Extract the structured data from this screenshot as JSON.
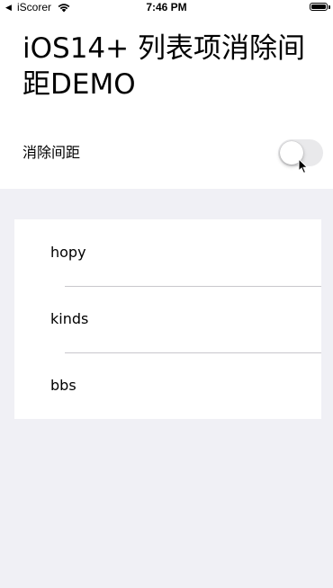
{
  "status_bar": {
    "back_glyph": "◀",
    "carrier": "iScorer",
    "wifi_icon": "wifi-icon",
    "time": "7:46 PM",
    "battery_icon": "battery-icon",
    "battery_level": 1.0
  },
  "header": {
    "title": "iOS14+ 列表项消除间距DEMO"
  },
  "settings": {
    "toggle_label": "消除间距",
    "toggle_on": false
  },
  "list": {
    "items": [
      {
        "label": "hopy"
      },
      {
        "label": "kinds"
      },
      {
        "label": "bbs"
      }
    ]
  },
  "colors": {
    "background": "#f0f0f5",
    "card": "#ffffff",
    "separator": "#c8c7cc",
    "switch_off": "#e9e9eb"
  }
}
